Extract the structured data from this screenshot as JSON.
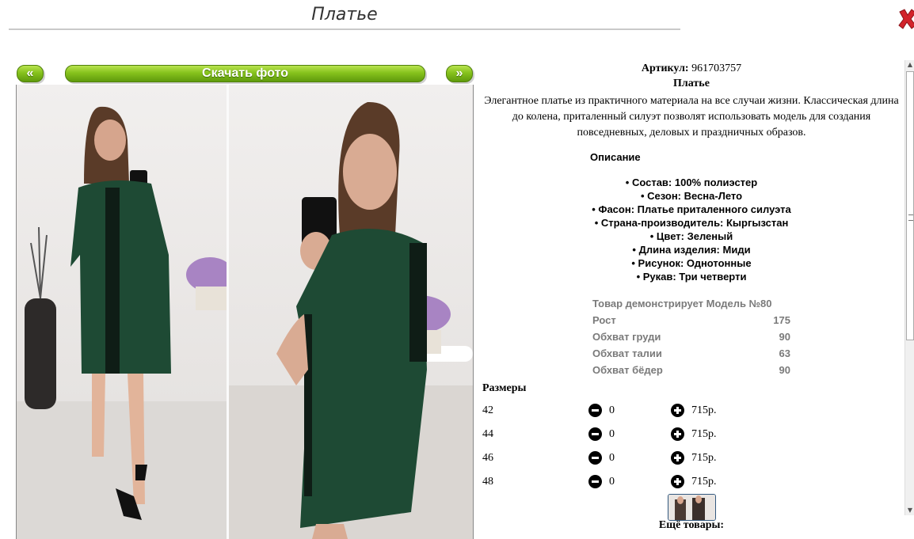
{
  "header": {
    "title": "Платье"
  },
  "gallery": {
    "prev_label": "«",
    "download_label": "Скачать фото",
    "next_label": "»"
  },
  "product": {
    "article_label": "Артикул:",
    "article_value": "961703757",
    "name": "Платье",
    "description": "Элегантное платье из практичного материала на все случаи жизни. Классическая длина до колена, приталенный силуэт позволят использовать модель для создания повседневных, деловых и праздничных образов.",
    "features_heading": "Описание",
    "features": [
      "• Состав: 100% полиэстер",
      "• Сезон: Весна-Лето",
      "• Фасон: Платье приталенного силуэта",
      "• Страна-производитель: Кыргызстан",
      "• Цвет: Зеленый",
      "• Длина изделия: Миди",
      "• Рисунок: Однотонные",
      "• Рукав: Три четверти"
    ],
    "model_params": [
      {
        "label": "Товар демонстрирует Модель №80",
        "value": ""
      },
      {
        "label": "Рост",
        "value": "175"
      },
      {
        "label": "Обхват груди",
        "value": "90"
      },
      {
        "label": "Обхват талии",
        "value": "63"
      },
      {
        "label": "Обхват бёдер",
        "value": "90"
      }
    ],
    "sizes_heading": "Размеры",
    "sizes": [
      {
        "size": "42",
        "qty": "0",
        "price": "715р."
      },
      {
        "size": "44",
        "qty": "0",
        "price": "715р."
      },
      {
        "size": "46",
        "qty": "0",
        "price": "715р."
      },
      {
        "size": "48",
        "qty": "0",
        "price": "715р."
      }
    ],
    "more_heading": "Ещё товары:"
  },
  "colors": {
    "accent_green": "#6fb31a",
    "dress_green": "#1e4a34",
    "close_red": "#d2232a"
  }
}
